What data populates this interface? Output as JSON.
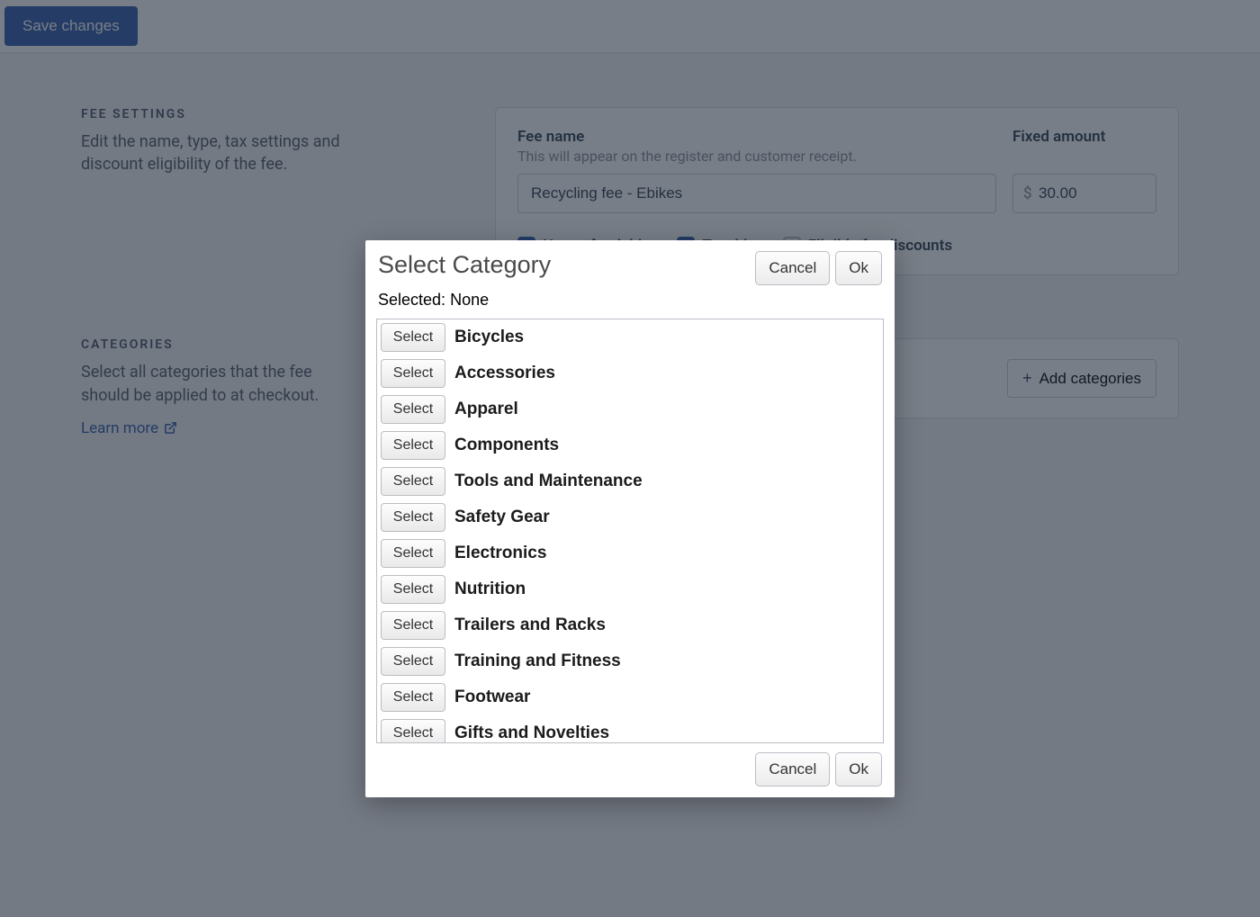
{
  "topbar": {
    "save_label": "Save changes"
  },
  "fee_settings": {
    "heading": "FEE SETTINGS",
    "desc": "Edit the name, type, tax settings and discount eligibility of the fee."
  },
  "fee_form": {
    "name_label": "Fee name",
    "name_sub": "This will appear on the register and customer receipt.",
    "name_value": "Recycling fee - Ebikes",
    "amount_label": "Fixed amount",
    "amount_value": "30.00",
    "currency": "$",
    "nonrefundable_label": "Non-refundable",
    "taxable_label": "Taxable",
    "discounts_label": "Eligible for discounts"
  },
  "categories": {
    "heading": "CATEGORIES",
    "desc": "Select all categories that the fee should be applied to at checkout.",
    "learn_more": "Learn more",
    "add_label": "Add categories"
  },
  "modal": {
    "title": "Select Category",
    "selected_prefix": "Selected:",
    "selected_value": "None",
    "cancel": "Cancel",
    "ok": "Ok",
    "select_label": "Select",
    "items": [
      "Bicycles",
      "Accessories",
      "Apparel",
      "Components",
      "Tools and Maintenance",
      "Safety Gear",
      "Electronics",
      "Nutrition",
      "Trailers and Racks",
      "Training and Fitness",
      "Footwear",
      "Gifts and Novelties"
    ]
  }
}
